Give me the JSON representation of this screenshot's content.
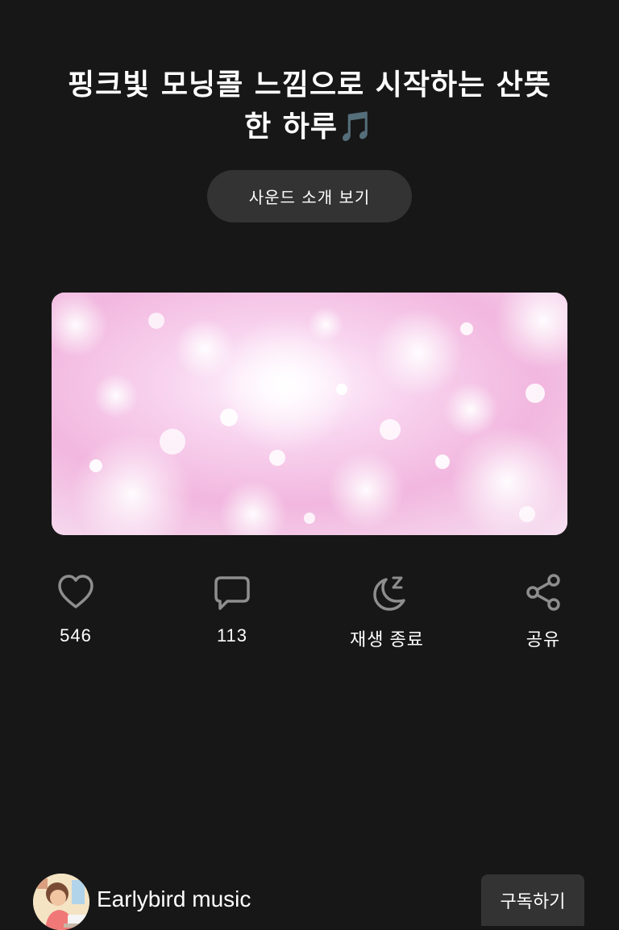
{
  "header": {
    "title_line1": "핑크빛 모닝콜 느낌으로 시작하는 산뜻",
    "title_line2": "한 하루",
    "title_emoji": "🎵"
  },
  "intro_button_label": "사운드 소개 보기",
  "visual": {
    "description_icon": "pink-bokeh-image",
    "accent_color": "#f5bde5"
  },
  "actions": {
    "like": {
      "icon": "heart-icon",
      "label": "546"
    },
    "comment": {
      "icon": "comment-icon",
      "label": "113"
    },
    "sleep": {
      "icon": "moon-sleep-icon",
      "label": "재생 종료"
    },
    "share": {
      "icon": "share-icon",
      "label": "공유"
    }
  },
  "footer": {
    "channel_name": "Earlybird music",
    "subscribe_label": "구독하기",
    "avatar_icon": "channel-avatar"
  },
  "colors": {
    "background": "#171717",
    "button": "#333333",
    "text": "#ffffff",
    "emoji": "#a45ee5"
  }
}
